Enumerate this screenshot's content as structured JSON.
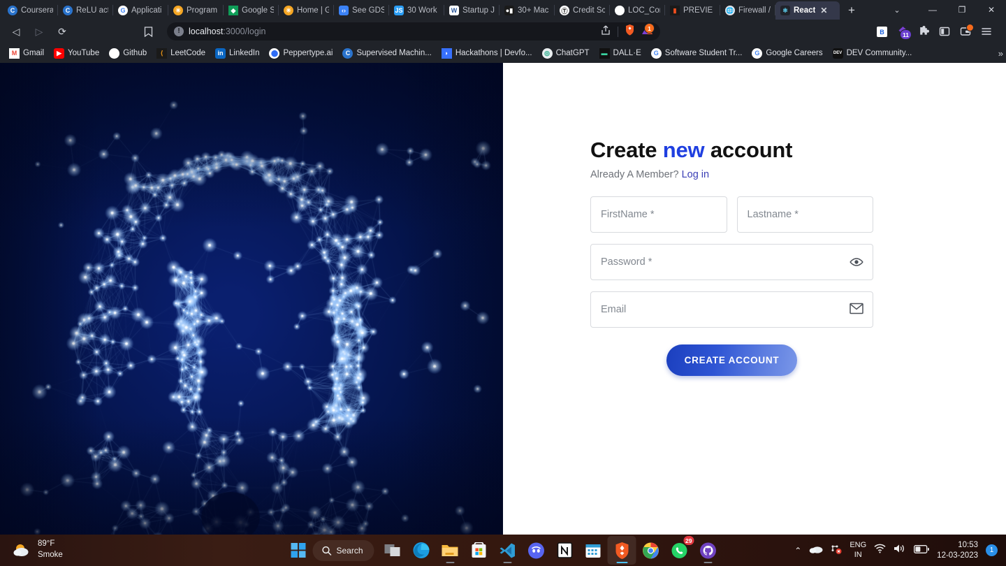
{
  "browser": {
    "tabs": [
      {
        "label": "Coursera",
        "icon": "coursera-icon",
        "active": false
      },
      {
        "label": "ReLU acti",
        "icon": "coursera-icon",
        "active": false
      },
      {
        "label": "Applicati",
        "icon": "google-icon",
        "active": false
      },
      {
        "label": "Program",
        "icon": "gdsc-icon",
        "active": false
      },
      {
        "label": "Google S",
        "icon": "google-drive-icon",
        "active": false
      },
      {
        "label": "Home | G",
        "icon": "gdsc-icon",
        "active": false
      },
      {
        "label": "See GDSC",
        "icon": "code-icon",
        "active": false
      },
      {
        "label": "30 Work",
        "icon": "js-icon",
        "active": false
      },
      {
        "label": "Startup J",
        "icon": "word-icon",
        "active": false
      },
      {
        "label": "30+ Mac",
        "icon": "video-icon",
        "active": false
      },
      {
        "label": "Credit Sc",
        "icon": "medium-icon",
        "active": false
      },
      {
        "label": "LOC_Con",
        "icon": "github-icon",
        "active": false
      },
      {
        "label": "PREVIE",
        "icon": "figma-icon",
        "active": false
      },
      {
        "label": "Firewall /",
        "icon": "globe-icon",
        "active": false
      },
      {
        "label": "React",
        "icon": "react-icon",
        "active": true
      }
    ],
    "new_tab_label": "+",
    "tab_search_label": "⌄",
    "window_controls": {
      "minimize": "—",
      "maximize": "❐",
      "close": "✕"
    },
    "nav": {
      "back": "◁",
      "forward": "▷",
      "reload": "⟳",
      "bookmark": "bookmark-icon"
    },
    "omnibox": {
      "url_host": "localhost",
      "url_rest": ":3000/login",
      "info_icon": "site-info-icon",
      "share_icon": "share-icon",
      "shield_icon": "brave-shields-icon",
      "shield_badge": "1"
    },
    "extensions": [
      {
        "name": "bitwarden-extension-icon",
        "label": "B",
        "badge": ""
      },
      {
        "name": "grammarly-extension-icon",
        "label": "",
        "badge": "11"
      },
      {
        "name": "extensions-puzzle-icon",
        "label": "",
        "badge": ""
      },
      {
        "name": "sidebar-toggle-icon",
        "label": "",
        "badge": ""
      },
      {
        "name": "brave-wallet-icon",
        "label": "",
        "badge": "•"
      },
      {
        "name": "browser-menu-icon",
        "label": "",
        "badge": ""
      }
    ],
    "bookmarks": [
      {
        "label": "Gmail",
        "icon": "gmail-icon"
      },
      {
        "label": "YouTube",
        "icon": "youtube-icon"
      },
      {
        "label": "Github",
        "icon": "github-icon"
      },
      {
        "label": "LeetCode",
        "icon": "leetcode-icon"
      },
      {
        "label": "LinkedIn",
        "icon": "linkedin-icon"
      },
      {
        "label": "Peppertype.ai",
        "icon": "peppertype-icon"
      },
      {
        "label": "Supervised Machin...",
        "icon": "coursera-icon"
      },
      {
        "label": "Hackathons | Devfo...",
        "icon": "devfolio-icon"
      },
      {
        "label": "ChatGPT",
        "icon": "chatgpt-icon"
      },
      {
        "label": "DALL·E",
        "icon": "dalle-icon"
      },
      {
        "label": "Software Student Tr...",
        "icon": "google-icon"
      },
      {
        "label": "Google Careers",
        "icon": "google-icon"
      },
      {
        "label": "DEV Community...",
        "icon": "dev-icon"
      }
    ],
    "bookmarks_overflow": "»"
  },
  "page": {
    "hero": {
      "alt": "wireframe-padlock-illustration"
    },
    "form": {
      "title_lead": "Create ",
      "title_accent": "new",
      "title_tail": " account",
      "subtitle_text": "Already A Member? ",
      "subtitle_link": "Log in",
      "fields": {
        "firstname": {
          "placeholder": "FirstName *",
          "value": ""
        },
        "lastname": {
          "placeholder": "Lastname *",
          "value": ""
        },
        "password": {
          "placeholder": "Password *",
          "value": "",
          "icon": "eye-icon"
        },
        "email": {
          "placeholder": "Email",
          "value": "",
          "icon": "envelope-icon"
        }
      },
      "submit_label": "CREATE ACCOUNT"
    },
    "colors": {
      "accent_blue": "#1f3fe0",
      "link_indigo": "#3b3fb6",
      "button_gradient_from": "#1b3fbe",
      "button_gradient_to": "#7a97e8"
    }
  },
  "taskbar": {
    "weather": {
      "temperature": "89°F",
      "condition": "Smoke"
    },
    "search_label": "Search",
    "items": [
      {
        "name": "task-view-icon",
        "badge": "",
        "active": false
      },
      {
        "name": "microsoft-edge-icon",
        "badge": "",
        "active": false
      },
      {
        "name": "file-explorer-icon",
        "badge": "",
        "active": false
      },
      {
        "name": "microsoft-store-icon",
        "badge": "",
        "active": false
      },
      {
        "name": "vscode-icon",
        "badge": "",
        "active": false
      },
      {
        "name": "discord-icon",
        "badge": "",
        "active": false
      },
      {
        "name": "notion-icon",
        "badge": "",
        "active": false
      },
      {
        "name": "calendar-icon",
        "badge": "",
        "active": false
      },
      {
        "name": "brave-browser-icon",
        "badge": "",
        "active": true
      },
      {
        "name": "google-chrome-icon",
        "badge": "",
        "active": false
      },
      {
        "name": "whatsapp-icon",
        "badge": "29",
        "active": false
      },
      {
        "name": "github-desktop-icon",
        "badge": "",
        "active": false
      }
    ],
    "tray": {
      "overflow": "⌃",
      "onedrive": "onedrive-icon",
      "network_error": "network-disconnected-icon",
      "language_line1": "ENG",
      "language_line2": "IN",
      "wifi": "wifi-icon",
      "volume": "volume-icon",
      "battery": "battery-icon",
      "time": "10:53",
      "date": "12-03-2023",
      "notification_count": "1"
    }
  }
}
